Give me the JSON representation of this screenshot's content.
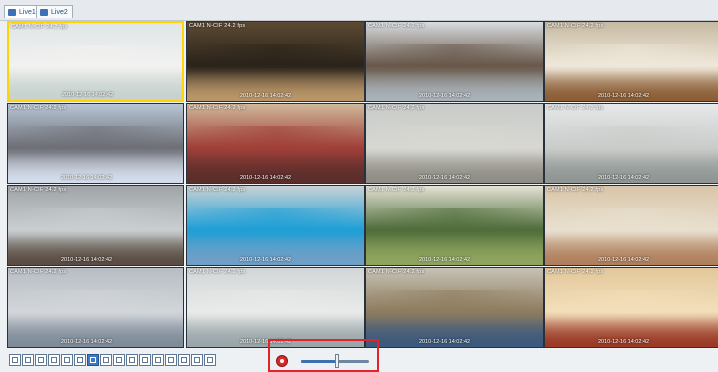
{
  "tabs": [
    {
      "label": "Live1",
      "active": true
    },
    {
      "label": "Live2",
      "active": false
    }
  ],
  "cameras": [
    {
      "label": "CAM1 N-CIF 24.2 fps",
      "timestamp": "2010-12-16  14:02:42",
      "colors": [
        "#dfe5e7",
        "#c7d2cf",
        "#f2f2f0"
      ]
    },
    {
      "label": "CAM1 N-CIF 24.2 fps",
      "timestamp": "2010-12-16  14:02:42",
      "colors": [
        "#5d4a33",
        "#b99668",
        "#2a231a"
      ]
    },
    {
      "label": "CAM1 N-CIF 24.2 fps",
      "timestamp": "2010-12-16  14:02:42",
      "colors": [
        "#d8dcdf",
        "#a9b2b9",
        "#68584a"
      ]
    },
    {
      "label": "CAM1 N-CIF 24.2 fps",
      "timestamp": "2010-12-16  14:02:42",
      "colors": [
        "#c6b9a1",
        "#8b5e36",
        "#efe8da"
      ]
    },
    {
      "label": "CAM1 N-CIF 24.2 fps",
      "timestamp": "2010-12-16  14:02:42",
      "colors": [
        "#b8c6d6",
        "#d3dcea",
        "#6e6f76"
      ]
    },
    {
      "label": "CAM1 N-CIF 24.2 fps",
      "timestamp": "2010-12-16  14:02:42",
      "colors": [
        "#d0b89a",
        "#5b2e2b",
        "#a04038"
      ]
    },
    {
      "label": "CAM1 N-CIF 24.2 fps",
      "timestamp": "2010-12-16  14:02:42",
      "colors": [
        "#c8cbc9",
        "#8f8d86",
        "#d8d8d2"
      ]
    },
    {
      "label": "CAM1 N-CIF 24.2 fps",
      "timestamp": "2010-12-16  14:02:42",
      "colors": [
        "#e6e8ea",
        "#8f9694",
        "#c9ccc9"
      ]
    },
    {
      "label": "CAM1 N-CIF 24.2 fps",
      "timestamp": "2010-12-16  14:02:42",
      "colors": [
        "#9fa3a7",
        "#5b4d43",
        "#c9cfd1"
      ]
    },
    {
      "label": "CAM1 N-CIF 24.2 fps",
      "timestamp": "2010-12-16  14:02:42",
      "colors": [
        "#c9d2d5",
        "#6f9fc7",
        "#1f9fd6"
      ]
    },
    {
      "label": "CAM1 N-CIF 24.2 fps",
      "timestamp": "2010-12-16  14:02:42",
      "colors": [
        "#e5e3d5",
        "#8fa55e",
        "#4f6d3a"
      ]
    },
    {
      "label": "CAM1 N-CIF 24.2 fps",
      "timestamp": "2010-12-16  14:02:42",
      "colors": [
        "#d9c5a8",
        "#b0805d",
        "#e8e0cf"
      ]
    },
    {
      "label": "CAM1 N-CIF 24.2 fps",
      "timestamp": "2010-12-16  14:02:42",
      "colors": [
        "#b7bdc3",
        "#7f8b99",
        "#d2d6da"
      ]
    },
    {
      "label": "CAM1 N-CIF 24.2 fps",
      "timestamp": "2010-12-16  14:02:42",
      "colors": [
        "#d1d6d8",
        "#9aa6aa",
        "#e9ebe9"
      ]
    },
    {
      "label": "CAM1 N-CIF 24.2 fps",
      "timestamp": "2010-12-16  14:02:42",
      "colors": [
        "#c7c2b5",
        "#3b5a7d",
        "#8e7c5e"
      ]
    },
    {
      "label": "CAM1 N-CIF 24.2 fps",
      "timestamp": "2010-12-16  14:02:42",
      "colors": [
        "#e3c79b",
        "#9a3a27",
        "#f2dfba"
      ]
    }
  ],
  "toolbar": {
    "layout_buttons": [
      {
        "name": "layout-1-button",
        "active": false
      },
      {
        "name": "layout-4-button",
        "active": false
      },
      {
        "name": "layout-6-button",
        "active": false
      },
      {
        "name": "layout-8-button",
        "active": false
      },
      {
        "name": "layout-9-button",
        "active": false
      },
      {
        "name": "layout-10-button",
        "active": false
      },
      {
        "name": "layout-16-button",
        "active": true
      },
      {
        "name": "layout-20-button",
        "active": false
      },
      {
        "name": "layout-25-button",
        "active": false
      },
      {
        "name": "layout-32-button",
        "active": false
      },
      {
        "name": "layout-36-button",
        "active": false
      },
      {
        "name": "layout-40-button",
        "active": false
      },
      {
        "name": "layout-48-button",
        "active": false
      },
      {
        "name": "layout-64-button",
        "active": false
      },
      {
        "name": "rotate-layout-button",
        "active": false
      },
      {
        "name": "fullscreen-button",
        "active": false
      }
    ],
    "record_icon": "record-icon",
    "volume_level": 0.53
  },
  "highlight_color": "#e1242a"
}
